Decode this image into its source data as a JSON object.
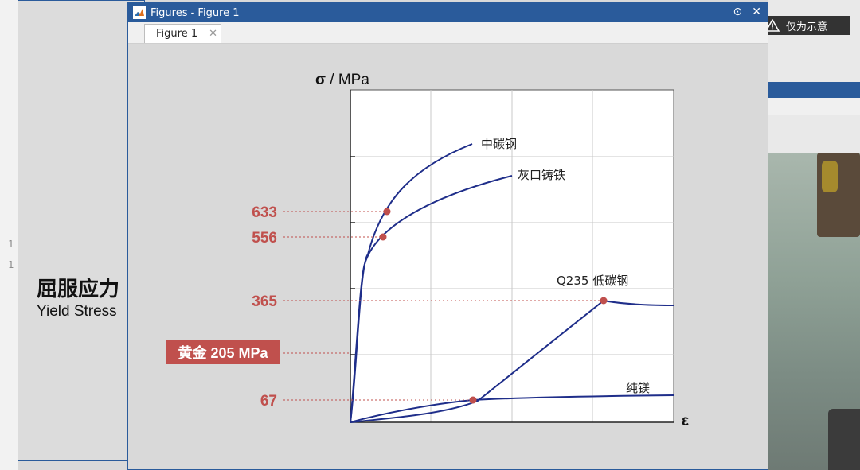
{
  "background_app": {
    "line_numbers": [
      "1",
      "1"
    ],
    "title_cn": "屈服应力",
    "title_en": "Yield Stress"
  },
  "notice": {
    "text": "仅为示意",
    "icon": "warning-icon"
  },
  "figure_window": {
    "title": "Figures - Figure 1",
    "tab_label": "Figure 1",
    "controls": [
      "options-icon",
      "close-icon"
    ]
  },
  "chart_data": {
    "type": "line",
    "ylabel_symbol": "σ",
    "ylabel_unit": " / MPa",
    "xlabel": "ε",
    "grid": true,
    "series": [
      {
        "name": "中碳钢",
        "color": "#1f2e8a"
      },
      {
        "name": "灰口铸铁",
        "color": "#1f2e8a"
      },
      {
        "name": "Q235 低碳钢",
        "color": "#1f2e8a"
      },
      {
        "name": "纯镁",
        "color": "#1f2e8a"
      }
    ],
    "yield_markers": [
      {
        "label": "633",
        "value": 633
      },
      {
        "label": "556",
        "value": 556
      },
      {
        "label": "365",
        "value": 365
      },
      {
        "label": "黄金 205 MPa",
        "value": 205
      },
      {
        "label": "67",
        "value": 67
      }
    ],
    "marker_color": "#c0504d"
  }
}
